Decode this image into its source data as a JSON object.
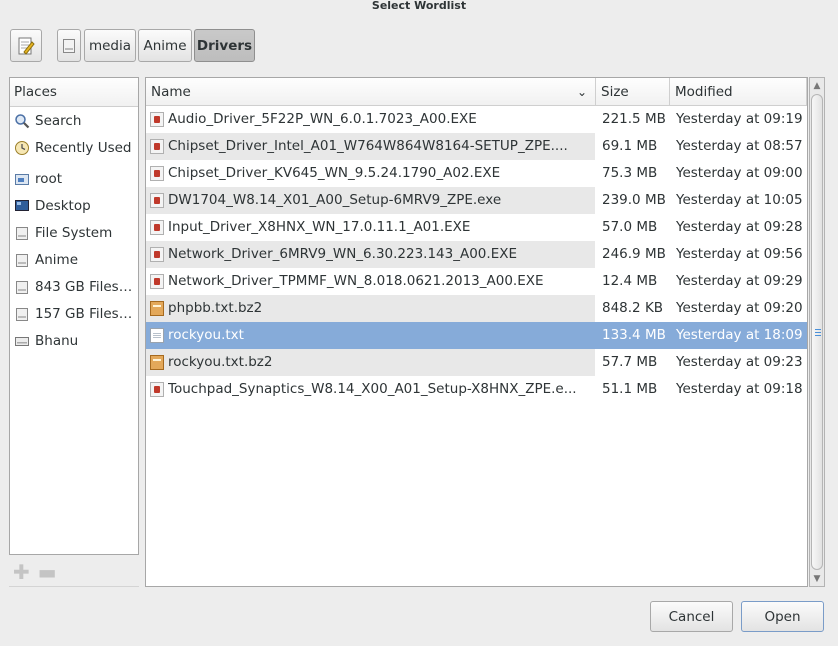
{
  "window": {
    "title": "Select Wordlist"
  },
  "pathbar": {
    "segments": [
      "media",
      "Anime",
      "Drivers"
    ],
    "active_segment": "Drivers"
  },
  "places": {
    "header": "Places",
    "items": [
      {
        "label": "Search",
        "icon": "search-icon"
      },
      {
        "label": "Recently Used",
        "icon": "clock-icon"
      },
      {
        "label": "root",
        "icon": "home-folder-icon"
      },
      {
        "label": "Desktop",
        "icon": "desktop-icon"
      },
      {
        "label": "File System",
        "icon": "drive-icon"
      },
      {
        "label": "Anime",
        "icon": "drive-icon"
      },
      {
        "label": "843 GB Files…",
        "icon": "drive-icon"
      },
      {
        "label": "157 GB Files…",
        "icon": "drive-icon"
      },
      {
        "label": "Bhanu",
        "icon": "network-drive-icon"
      }
    ]
  },
  "filelist": {
    "columns": {
      "name": "Name",
      "size": "Size",
      "modified": "Modified"
    },
    "rows": [
      {
        "name": "Audio_Driver_5F22P_WN_6.0.1.7023_A00.EXE",
        "size": "221.5 MB",
        "modified": "Yesterday at 09:19",
        "icon": "executable-icon"
      },
      {
        "name": "Chipset_Driver_Intel_A01_W764W864W8164-SETUP_ZPE....",
        "size": "69.1 MB",
        "modified": "Yesterday at 08:57",
        "icon": "executable-icon"
      },
      {
        "name": "Chipset_Driver_KV645_WN_9.5.24.1790_A02.EXE",
        "size": "75.3 MB",
        "modified": "Yesterday at 09:00",
        "icon": "executable-icon"
      },
      {
        "name": "DW1704_W8.14_X01_A00_Setup-6MRV9_ZPE.exe",
        "size": "239.0 MB",
        "modified": "Yesterday at 10:05",
        "icon": "executable-icon"
      },
      {
        "name": "Input_Driver_X8HNX_WN_17.0.11.1_A01.EXE",
        "size": "57.0 MB",
        "modified": "Yesterday at 09:28",
        "icon": "executable-icon"
      },
      {
        "name": "Network_Driver_6MRV9_WN_6.30.223.143_A00.EXE",
        "size": "246.9 MB",
        "modified": "Yesterday at 09:56",
        "icon": "executable-icon"
      },
      {
        "name": "Network_Driver_TPMMF_WN_8.018.0621.2013_A00.EXE",
        "size": "12.4 MB",
        "modified": "Yesterday at 09:29",
        "icon": "executable-icon"
      },
      {
        "name": "phpbb.txt.bz2",
        "size": "848.2 KB",
        "modified": "Yesterday at 09:20",
        "icon": "archive-icon"
      },
      {
        "name": "rockyou.txt",
        "size": "133.4 MB",
        "modified": "Yesterday at 18:09",
        "icon": "text-file-icon",
        "selected": true
      },
      {
        "name": "rockyou.txt.bz2",
        "size": "57.7 MB",
        "modified": "Yesterday at 09:23",
        "icon": "archive-icon"
      },
      {
        "name": "Touchpad_Synaptics_W8.14_X00_A01_Setup-X8HNX_ZPE.e...",
        "size": "51.1 MB",
        "modified": "Yesterday at 09:18",
        "icon": "executable-icon"
      }
    ]
  },
  "actions": {
    "cancel_label": "Cancel",
    "open_label": "Open"
  },
  "colors": {
    "selection": "#86abd9",
    "window_bg": "#ededed"
  }
}
